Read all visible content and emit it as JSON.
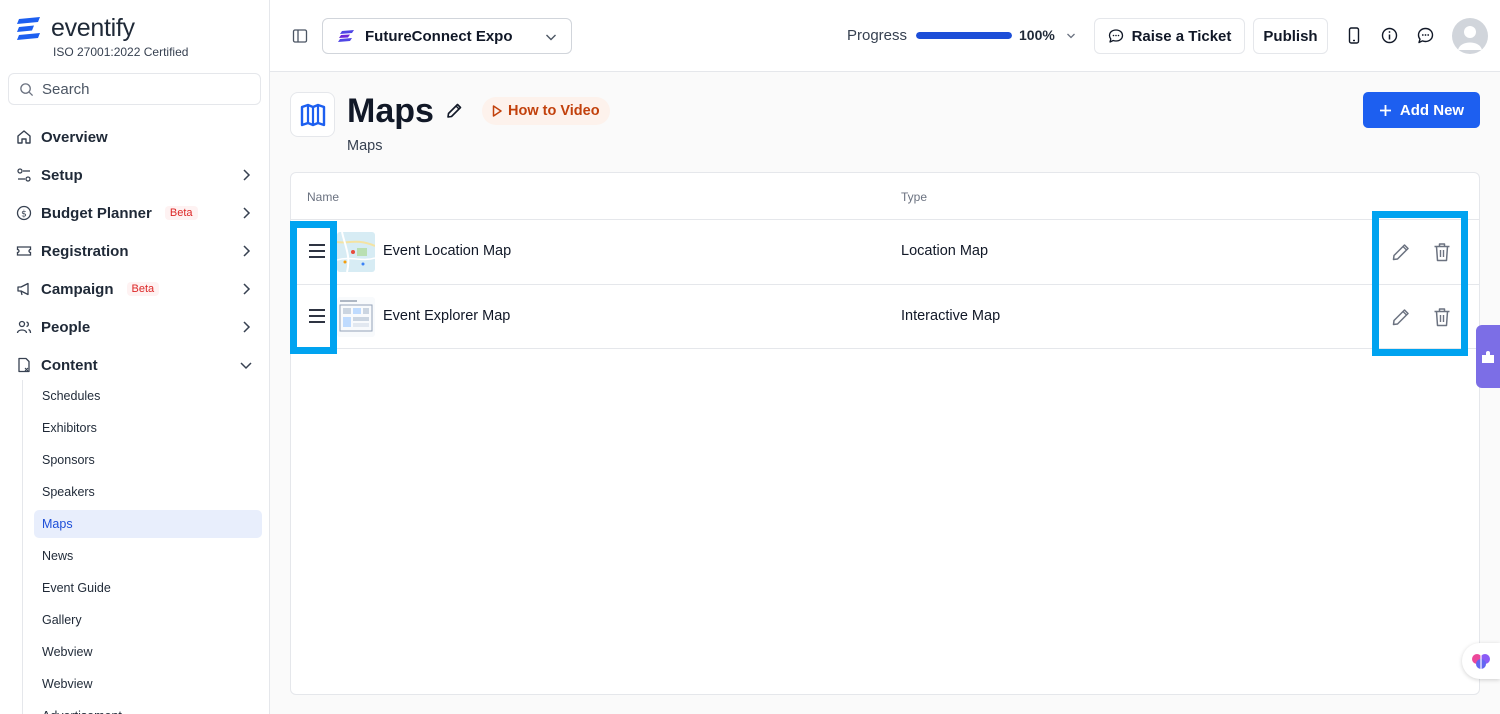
{
  "brand": {
    "name": "eventify",
    "certification": "ISO 27001:2022 Certified",
    "color": "#1d5ff0"
  },
  "search": {
    "placeholder": "Search"
  },
  "nav": {
    "overview": "Overview",
    "setup": "Setup",
    "budget": "Budget Planner",
    "budget_badge": "Beta",
    "registration": "Registration",
    "campaign": "Campaign",
    "campaign_badge": "Beta",
    "people": "People",
    "content": "Content"
  },
  "content_items": [
    "Schedules",
    "Exhibitors",
    "Sponsors",
    "Speakers",
    "Maps",
    "News",
    "Event Guide",
    "Gallery",
    "Webview",
    "Webview",
    "Advertisement"
  ],
  "active_content_item": "Maps",
  "header": {
    "event": "FutureConnect Expo",
    "progress_label": "Progress",
    "progress_value": "100%",
    "progress_fraction": 1.0,
    "raise_ticket": "Raise a Ticket",
    "publish": "Publish",
    "icons": [
      "sidebar-toggle-icon",
      "mobile-icon",
      "info-icon",
      "chat-icon",
      "user-avatar"
    ]
  },
  "page": {
    "title": "Maps",
    "subtitle": "Maps",
    "how_to": "How to Video",
    "add_new": "Add New"
  },
  "table": {
    "columns": [
      "Name",
      "Type"
    ],
    "rows": [
      {
        "name": "Event Location Map",
        "type": "Location Map"
      },
      {
        "name": "Event Explorer Map",
        "type": "Interactive Map"
      }
    ]
  },
  "colors": {
    "accent": "#1d5ff0",
    "highlight": "#00a3f0",
    "beta": "#dc2626",
    "how_to": "#c2410c",
    "widget": "#7c6ee6"
  }
}
